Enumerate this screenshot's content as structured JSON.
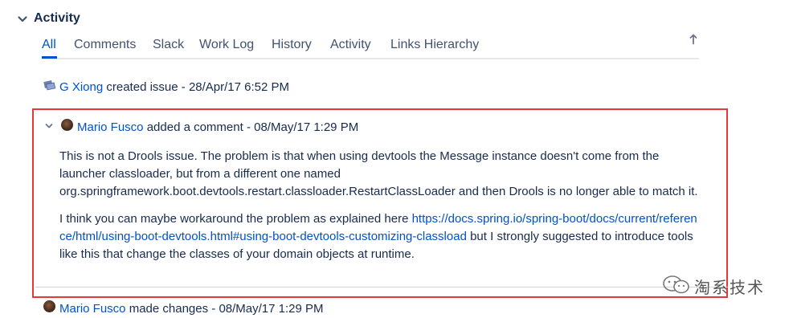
{
  "section": {
    "title": "Activity",
    "toggle_icon": "chevron-down-icon"
  },
  "tabs": [
    {
      "label": "All",
      "active": true
    },
    {
      "label": "Comments",
      "active": false
    },
    {
      "label": "Slack",
      "active": false
    },
    {
      "label": "Work Log",
      "active": false
    },
    {
      "label": "History",
      "active": false
    },
    {
      "label": "Activity",
      "active": false
    },
    {
      "label": "Links Hierarchy",
      "active": false
    }
  ],
  "sort_icon": "arrow-up-icon",
  "entries": {
    "created": {
      "author": "G Xiong",
      "action": "created issue",
      "separator": " - ",
      "time": "28/Apr/17 6:52 PM"
    },
    "comment": {
      "author": "Mario Fusco",
      "action": "added a comment",
      "separator": " - ",
      "time": "08/May/17 1:29 PM",
      "paragraph1": "This is not a Drools issue. The problem is that when using devtools the Message instance doesn't come from the launcher classloader, but from a different one named org.springframework.boot.devtools.restart.classloader.RestartClassLoader and then Drools is no longer able to match it.",
      "paragraph2_before": "I think you can maybe workaround the problem as explained here ",
      "paragraph2_link": "https://docs.spring.io/spring-boot/docs/current/reference/html/using-boot-devtools.html#using-boot-devtools-customizing-classload",
      "paragraph2_after": " but I strongly suggested to introduce tools like this that change the classes of your domain objects at runtime."
    },
    "changes": {
      "author": "Mario Fusco",
      "action": "made changes",
      "separator": " - ",
      "time": "08/May/17 1:29 PM"
    }
  },
  "watermark": {
    "text": "淘系技术"
  },
  "colors": {
    "link": "#0052cc",
    "highlight": "#e53935",
    "text": "#172b4d",
    "tab": "#42526e"
  }
}
